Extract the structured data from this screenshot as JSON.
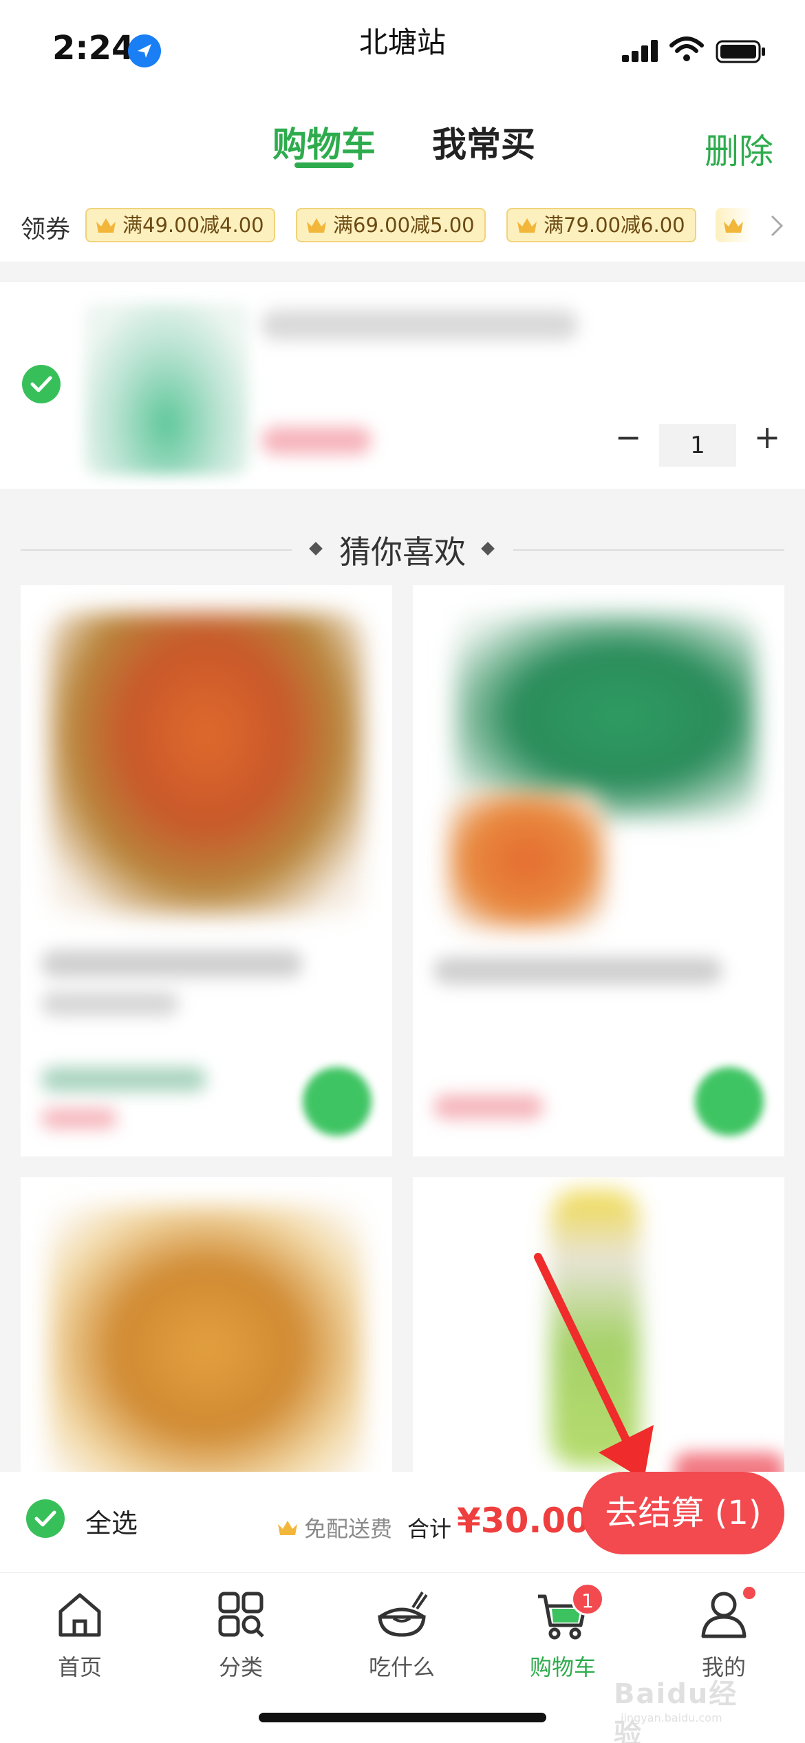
{
  "status_bar": {
    "time": "2:24",
    "store_name": "北塘站"
  },
  "tabs": {
    "active": "购物车",
    "other": "我常买",
    "delete": "删除"
  },
  "coupons": {
    "label": "领券",
    "items": [
      "满49.00减4.00",
      "满69.00减5.00",
      "满79.00减6.00"
    ]
  },
  "cart_item": {
    "quantity": "1",
    "minus": "−",
    "plus": "+"
  },
  "recommend": {
    "title": "猜你喜欢"
  },
  "bottom_bar": {
    "select_all": "全选",
    "free_shipping": "免配送费",
    "total_label": "合计",
    "total_amount": "¥30.00",
    "checkout": "去结算 (1)"
  },
  "tabbar": {
    "items": [
      {
        "label": "首页"
      },
      {
        "label": "分类"
      },
      {
        "label": "吃什么"
      },
      {
        "label": "购物车",
        "badge": "1"
      },
      {
        "label": "我的"
      }
    ]
  },
  "watermark": {
    "text": "Baidu经验",
    "sub": "jingyan.baidu.com"
  },
  "colors": {
    "accent": "#2eac4d",
    "price": "#ef3e3e",
    "checkout": "#f24a4f",
    "coupon_bg": "#fdf0bf"
  }
}
